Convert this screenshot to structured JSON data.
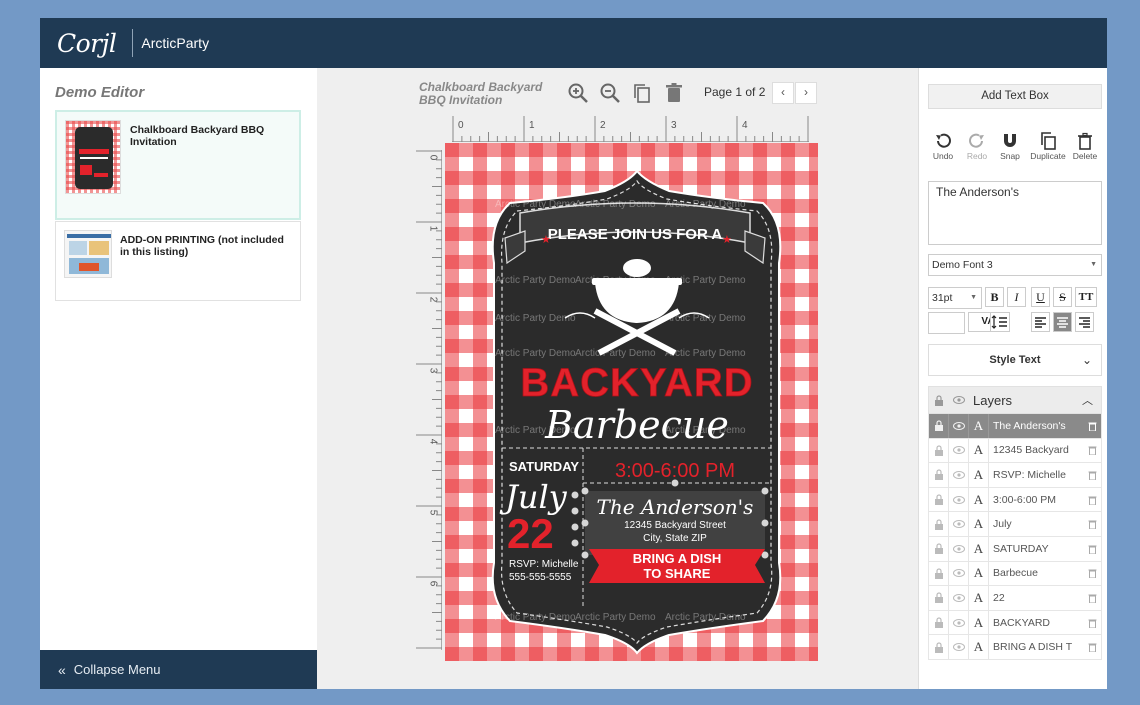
{
  "header": {
    "logo": "Corjl",
    "store": "ArcticParty"
  },
  "left_panel": {
    "title": "Demo Editor",
    "products": [
      {
        "title": "Chalkboard Backyard BBQ Invitation"
      },
      {
        "title": "ADD-ON PRINTING (not included in this listing)"
      }
    ],
    "collapse_label": "Collapse Menu"
  },
  "canvas": {
    "document_title": "Chalkboard Backyard BBQ Invitation",
    "page_indicator": "Page 1 of 2",
    "ruler_top": [
      "0",
      "1",
      "2",
      "3",
      "4"
    ],
    "ruler_left": [
      "0",
      "1",
      "2",
      "3",
      "4",
      "5",
      "6"
    ],
    "design": {
      "banner": "PLEASE JOIN US FOR A",
      "headline": "BACKYARD",
      "script_title": "Barbecue",
      "day": "SATURDAY",
      "month": "July",
      "date": "22",
      "rsvp_line1": "RSVP: Michelle",
      "rsvp_line2": "555-555-5555",
      "time": "3:00-6:00 PM",
      "host": "The Anderson's",
      "address1": "12345 Backyard Street",
      "address2": "City, State ZIP",
      "dish1": "BRING A DISH",
      "dish2": "TO SHARE",
      "watermark": "Arctic Party Demo"
    }
  },
  "right_panel": {
    "add_text_box": "Add Text Box",
    "actions": [
      "Undo",
      "Redo",
      "Snap",
      "Duplicate",
      "Delete"
    ],
    "text_value": "The Anderson's",
    "font": "Demo Font 3",
    "font_size": "31pt",
    "style_text": "Style Text",
    "layers_title": "Layers",
    "layers": [
      "The Anderson's",
      "12345 Backyard",
      "RSVP: Michelle",
      "3:00-6:00 PM",
      "July",
      "SATURDAY",
      "Barbecue",
      "22",
      "BACKYARD",
      "BRING A DISH T"
    ]
  },
  "colors": {
    "header": "#1f3a54",
    "background": "#7399c6",
    "accent_red": "#e3222b",
    "chalkboard": "#2b2b2b"
  }
}
